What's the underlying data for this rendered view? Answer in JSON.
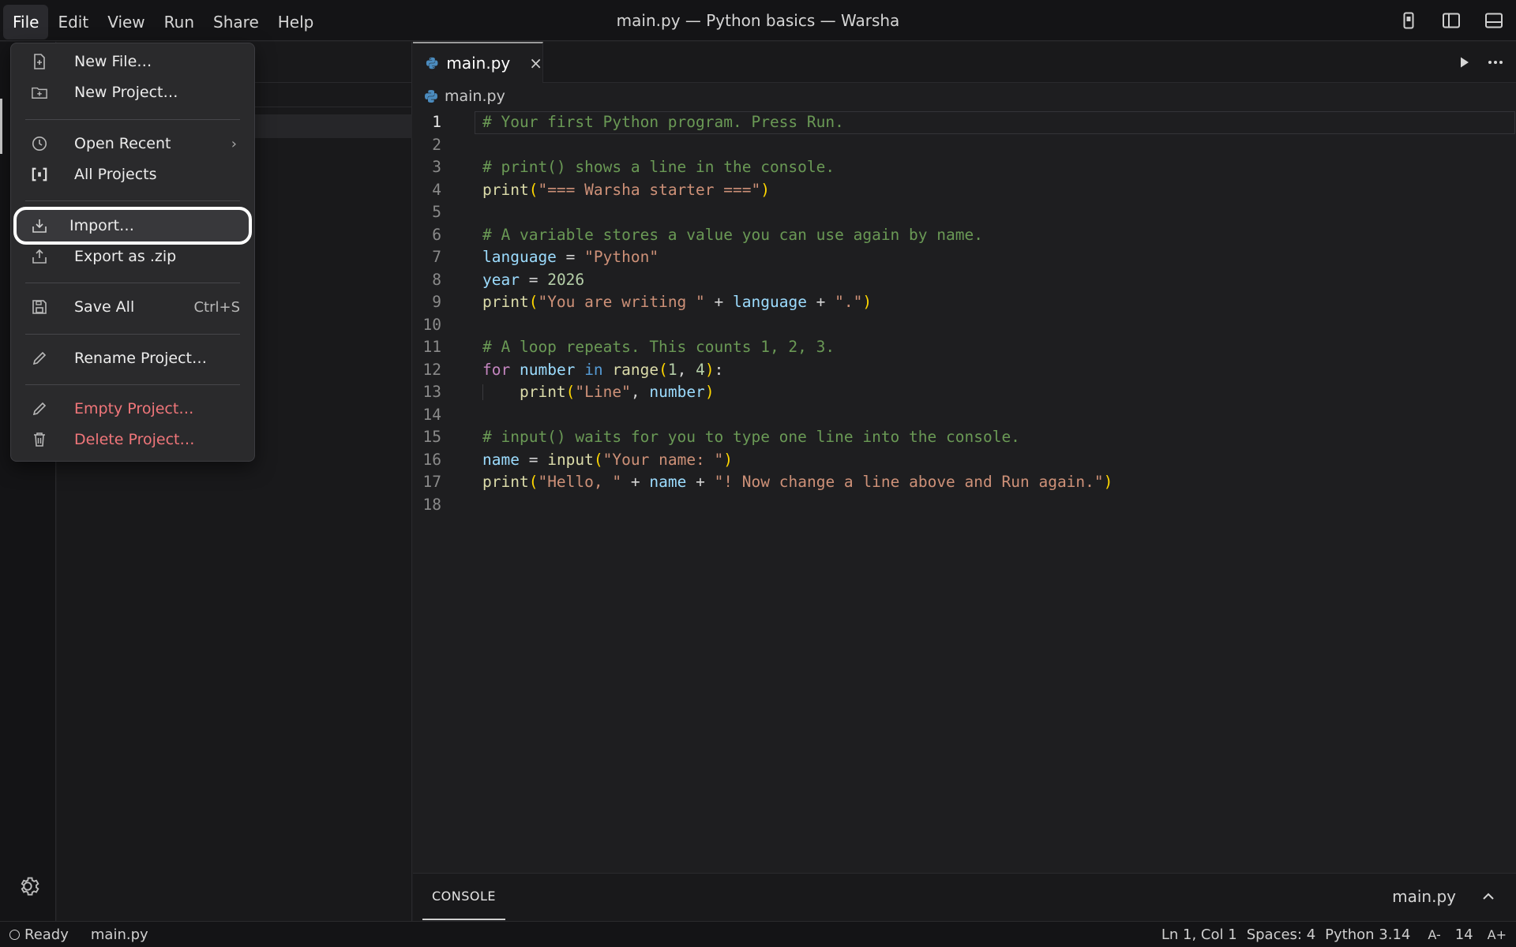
{
  "menubar": {
    "items": [
      "File",
      "Edit",
      "View",
      "Run",
      "Share",
      "Help"
    ],
    "active": "File"
  },
  "window": {
    "title": "main.py — Python basics — Warsha"
  },
  "editor": {
    "tab": {
      "label": "main.py",
      "close": "×"
    },
    "breadcrumb": "main.py",
    "cursor_line": 1,
    "lines": [
      [
        [
          "c-com",
          "# Your first Python program. Press Run."
        ]
      ],
      [],
      [
        [
          "c-com",
          "# print() shows a line in the console."
        ]
      ],
      [
        [
          "c-fn",
          "print"
        ],
        [
          "c-p1",
          "("
        ],
        [
          "c-str",
          "\"=== Warsha starter ===\""
        ],
        [
          "c-p1",
          ")"
        ]
      ],
      [],
      [
        [
          "c-com",
          "# A variable stores a value you can use again by name."
        ]
      ],
      [
        [
          "c-var",
          "language"
        ],
        [
          "c-op",
          " = "
        ],
        [
          "c-str",
          "\"Python\""
        ]
      ],
      [
        [
          "c-var",
          "year"
        ],
        [
          "c-op",
          " = "
        ],
        [
          "c-num",
          "2026"
        ]
      ],
      [
        [
          "c-fn",
          "print"
        ],
        [
          "c-p1",
          "("
        ],
        [
          "c-str",
          "\"You are writing \""
        ],
        [
          "c-op",
          " + "
        ],
        [
          "c-var",
          "language"
        ],
        [
          "c-op",
          " + "
        ],
        [
          "c-str",
          "\".\""
        ],
        [
          "c-p1",
          ")"
        ]
      ],
      [],
      [
        [
          "c-com",
          "# A loop repeats. This counts 1, 2, 3."
        ]
      ],
      [
        [
          "c-kw",
          "for"
        ],
        [
          "c-op",
          " "
        ],
        [
          "c-var",
          "number"
        ],
        [
          "c-op",
          " "
        ],
        [
          "c-kw2",
          "in"
        ],
        [
          "c-op",
          " "
        ],
        [
          "c-fn",
          "range"
        ],
        [
          "c-p1",
          "("
        ],
        [
          "c-num",
          "1"
        ],
        [
          "c-op",
          ", "
        ],
        [
          "c-num",
          "4"
        ],
        [
          "c-p1",
          ")"
        ],
        [
          "c-op",
          ":"
        ]
      ],
      [
        [
          "c-op",
          "    "
        ],
        [
          "c-fn",
          "print"
        ],
        [
          "c-p1",
          "("
        ],
        [
          "c-str",
          "\"Line\""
        ],
        [
          "c-op",
          ", "
        ],
        [
          "c-var",
          "number"
        ],
        [
          "c-p1",
          ")"
        ]
      ],
      [],
      [
        [
          "c-com",
          "# input() waits for you to type one line into the console."
        ]
      ],
      [
        [
          "c-var",
          "name"
        ],
        [
          "c-op",
          " = "
        ],
        [
          "c-fn",
          "input"
        ],
        [
          "c-p1",
          "("
        ],
        [
          "c-str",
          "\"Your name: \""
        ],
        [
          "c-p1",
          ")"
        ]
      ],
      [
        [
          "c-fn",
          "print"
        ],
        [
          "c-p1",
          "("
        ],
        [
          "c-str",
          "\"Hello, \""
        ],
        [
          "c-op",
          " + "
        ],
        [
          "c-var",
          "name"
        ],
        [
          "c-op",
          " + "
        ],
        [
          "c-str",
          "\"! Now change a line above and Run again.\""
        ],
        [
          "c-p1",
          ")"
        ]
      ],
      []
    ]
  },
  "console": {
    "tab_label": "CONSOLE",
    "file": "main.py"
  },
  "status": {
    "state": "Ready",
    "file": "main.py",
    "position": "Ln 1, Col 1",
    "spaces": "Spaces: 4",
    "language": "Python 3.14",
    "font_decrease": "A-",
    "font_size": "14",
    "font_increase": "A+"
  },
  "file_menu": {
    "items": [
      {
        "label": "New File…",
        "icon": "new-file-icon"
      },
      {
        "label": "New Project…",
        "icon": "new-folder-icon"
      },
      {
        "label": "Open Recent",
        "icon": "clock-icon",
        "submenu": "›"
      },
      {
        "label": "All Projects",
        "icon": "projects-icon"
      },
      {
        "label": "Import…",
        "icon": "import-icon",
        "focused": true
      },
      {
        "label": "Export as .zip",
        "icon": "export-icon"
      },
      {
        "label": "Save All",
        "icon": "save-icon",
        "shortcut": "Ctrl+S"
      },
      {
        "label": "Rename Project…",
        "icon": "pencil-icon"
      },
      {
        "label": "Empty Project…",
        "icon": "eraser-icon",
        "danger": true
      },
      {
        "label": "Delete Project…",
        "icon": "trash-icon",
        "danger": true
      }
    ]
  },
  "colors": {
    "danger": "#f0767a",
    "comment": "#6a9955",
    "string": "#ce9178",
    "function": "#dcdcaa",
    "variable": "#9cdcfe"
  }
}
